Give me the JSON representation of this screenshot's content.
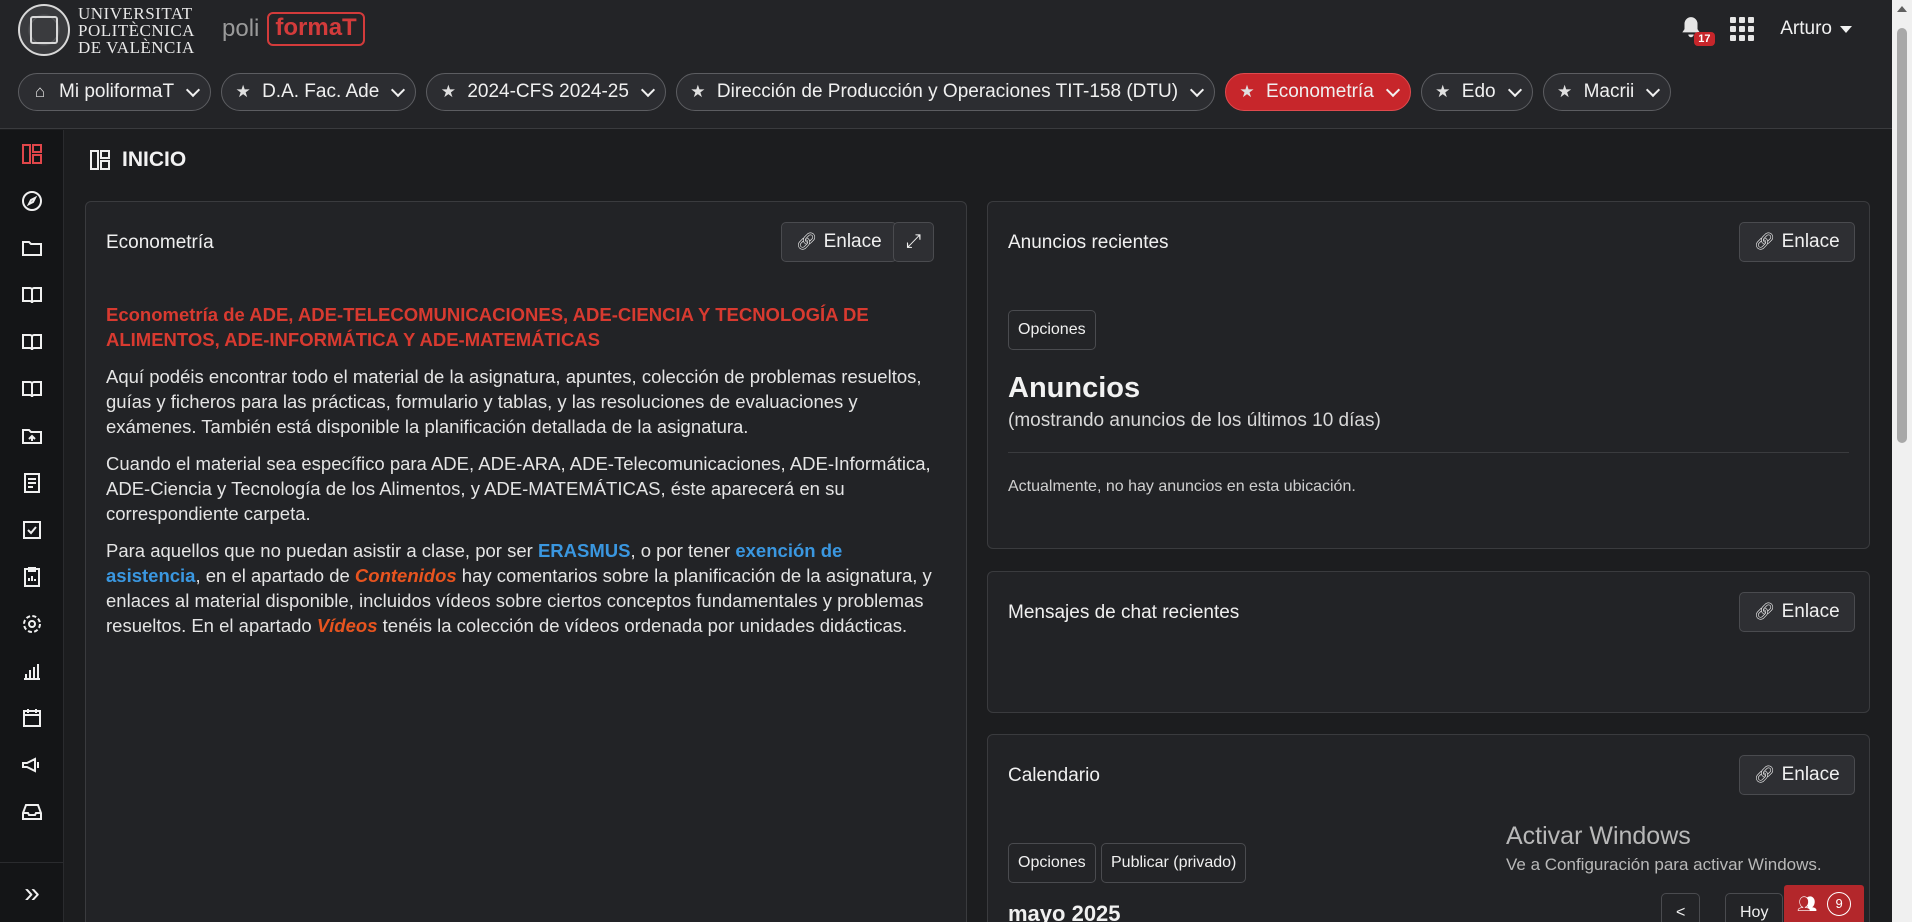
{
  "header": {
    "university_lines": [
      "UNIVERSITAT",
      "POLITÈCNICA",
      "DE VALÈNCIA"
    ],
    "brand_prefix": "poli",
    "brand_bracket": "[formaT]",
    "notifications_count": "17",
    "user_name": "Arturo"
  },
  "pills": [
    {
      "label": "Mi poliformaT",
      "icon": "home-icon",
      "active": false
    },
    {
      "label": "D.A. Fac. Ade",
      "icon": "star-icon",
      "active": false
    },
    {
      "label": "2024-CFS 2024-25",
      "icon": "star-icon",
      "active": false
    },
    {
      "label": "Dirección de Producción y Operaciones TIT-158 (DTU)",
      "icon": "star-icon",
      "active": false
    },
    {
      "label": "Econometría",
      "icon": "star-icon",
      "active": true
    },
    {
      "label": "Edo",
      "icon": "star-icon",
      "active": false
    },
    {
      "label": "Macrii",
      "icon": "star-icon",
      "active": false
    }
  ],
  "sidebar": {
    "items": [
      "dashboard-icon",
      "compass-icon",
      "folder-icon",
      "book-icon",
      "book-open-icon",
      "book-alt-icon",
      "folder-share-icon",
      "receipt-icon",
      "check-square-icon",
      "clipboard-icon",
      "gear-icon",
      "bar-chart-icon",
      "calendar-icon",
      "megaphone-icon",
      "inbox-icon"
    ],
    "toggle": "»"
  },
  "page": {
    "title": "INICIO"
  },
  "econometria": {
    "title": "Econometría",
    "link_label": "Enlace",
    "heading": "Econometría de ADE, ADE-TELECOMUNICACIONES, ADE-CIENCIA Y TECNOLOGÍA DE ALIMENTOS, ADE-INFORMÁTICA Y ADE-MATEMÁTICAS",
    "p1": "Aquí podéis encontrar todo el material de la asignatura, apuntes, colección de problemas resueltos, guías y ficheros para las prácticas, formulario y tablas, y las resoluciones de evaluaciones y exámenes. También está disponible la planificación detallada de la asignatura.",
    "p2": "Cuando el material sea específico para ADE, ADE-ARA, ADE-Telecomunicaciones, ADE-Informática, ADE-Ciencia y Tecnología de los Alimentos, y ADE-MATEMÁTICAS, éste aparecerá en su correspondiente carpeta.",
    "p3_a": "Para aquellos que no puedan asistir a clase, por ser ",
    "p3_erasmus": "ERASMUS",
    "p3_b": ", o por tener ",
    "p3_exencion": "exención de asistencia",
    "p3_c": ", en el apartado de ",
    "p3_contenidos": "Contenidos",
    "p3_d": " hay comentarios sobre la planificación de la asignatura, y enlaces al material disponible, incluidos vídeos sobre ciertos conceptos fundamentales y problemas resueltos. En el apartado ",
    "p3_videos": "Vídeos",
    "p3_e": " tenéis la colección de vídeos ordenada por unidades didácticas."
  },
  "anuncios": {
    "title": "Anuncios recientes",
    "link_label": "Enlace",
    "options_label": "Opciones",
    "heading": "Anuncios",
    "subtitle": "(mostrando anuncios de los últimos 10 días)",
    "empty_message": "Actualmente, no hay anuncios en esta ubicación."
  },
  "chat": {
    "title": "Mensajes de chat recientes",
    "link_label": "Enlace"
  },
  "calendario": {
    "title": "Calendario",
    "link_label": "Enlace",
    "options_label": "Opciones",
    "publish_label": "Publicar (privado)",
    "month": "mayo 2025",
    "prev_label": "<",
    "today_label": "Hoy"
  },
  "watermark": {
    "line1": "Activar Windows",
    "line2": "Ve a Configuración para activar Windows."
  },
  "chat_fab": {
    "count": "9"
  }
}
